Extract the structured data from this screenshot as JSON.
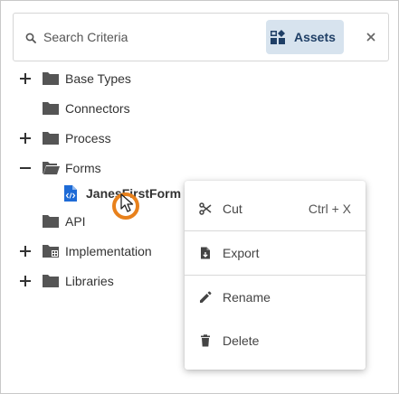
{
  "search": {
    "placeholder": "Search Criteria",
    "value": ""
  },
  "assets_button": {
    "label": "Assets",
    "active": true
  },
  "tree": {
    "nodes": [
      {
        "label": "Base Types",
        "expander": "plus",
        "icon": "folder-icon"
      },
      {
        "label": "Connectors",
        "expander": "none",
        "icon": "folder-icon"
      },
      {
        "label": "Process",
        "expander": "plus",
        "icon": "folder-icon"
      },
      {
        "label": "Forms",
        "expander": "minus",
        "icon": "folder-open-icon"
      },
      {
        "label": "JanesFirstForm",
        "expander": "none",
        "icon": "form-file-icon",
        "selected": true
      },
      {
        "label": "API",
        "expander": "none",
        "icon": "folder-icon"
      },
      {
        "label": "Implementation",
        "expander": "plus",
        "icon": "folder-package-icon"
      },
      {
        "label": "Libraries",
        "expander": "plus",
        "icon": "folder-icon"
      }
    ]
  },
  "context_menu": {
    "items": [
      {
        "label": "Cut",
        "shortcut": "Ctrl + X",
        "icon": "scissors-icon"
      },
      {
        "label": "Export",
        "shortcut": "",
        "icon": "export-file-icon"
      },
      {
        "label": "Rename",
        "shortcut": "",
        "icon": "pencil-icon"
      },
      {
        "label": "Delete",
        "shortcut": "",
        "icon": "trash-icon"
      }
    ]
  },
  "colors": {
    "accent": "#1f3f66",
    "assets_bg": "#d7e3ee",
    "folder": "#555555",
    "file_icon": "#1e6bd6",
    "cursor_ring": "#e8811c"
  }
}
